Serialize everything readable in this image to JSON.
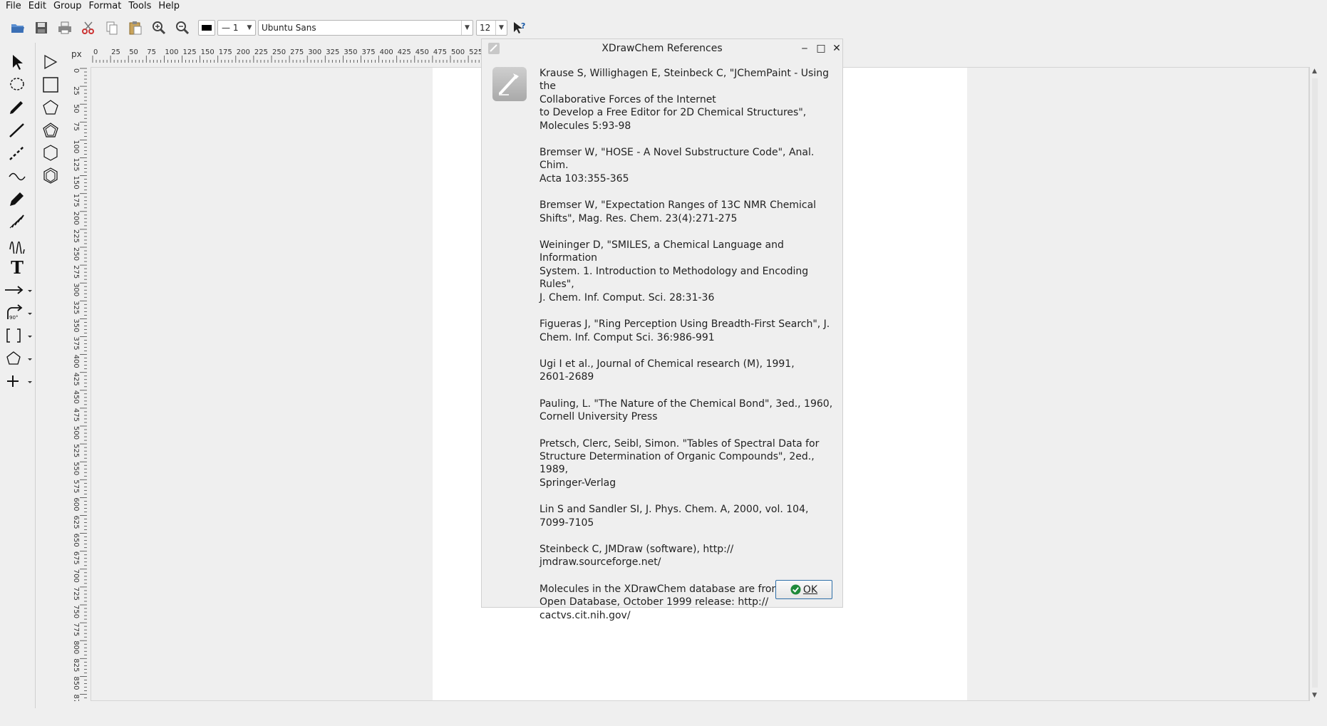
{
  "menubar": {
    "items": [
      "File",
      "Edit",
      "Group",
      "Format",
      "Tools",
      "Help"
    ]
  },
  "toolbar": {
    "icons": [
      "open-folder-icon",
      "save-icon",
      "print-icon",
      "cut-icon",
      "copy-icon",
      "paste-icon",
      "zoom-in-icon",
      "zoom-out-icon"
    ],
    "line_width": "— 1",
    "font_family": "Ubuntu Sans",
    "font_size": "12",
    "help_icon": "whats-this-icon"
  },
  "palette": {
    "tools": [
      "select-arrow-icon",
      "lasso-icon",
      "pencil-icon",
      "line-icon",
      "dashed-line-icon",
      "wavy-line-icon",
      "pen-icon",
      "hatch-icon",
      "squiggle-icon",
      "text-tool-icon",
      "arrow-tool-icon",
      "curved-arrow-icon",
      "bracket-icon",
      "ring-icon",
      "plus-icon"
    ],
    "tools_right": [
      "rotate-select-icon",
      "rectangle-icon",
      "pentagon-icon",
      "pentagon-filled-icon",
      "hexagon-icon",
      "hexagon-3d-icon"
    ],
    "text_tool_label": "T",
    "curved_arrow_label": "90°"
  },
  "ruler": {
    "unit": "px",
    "h_ticks": [
      "0",
      "25",
      "50",
      "75",
      "100",
      "125",
      "150",
      "175",
      "200",
      "225",
      "250",
      "275",
      "300",
      "325",
      "350",
      "375",
      "400",
      "425",
      "450",
      "475",
      "500",
      "525",
      "55"
    ],
    "v_ticks": [
      "0",
      "25",
      "50",
      "75",
      "100",
      "125",
      "150",
      "175",
      "200",
      "225",
      "250",
      "275",
      "300",
      "325",
      "350",
      "375",
      "400",
      "425",
      "450",
      "475",
      "500",
      "525",
      "550",
      "575",
      "600",
      "625",
      "650",
      "675",
      "700",
      "725",
      "750",
      "775",
      "800",
      "825",
      "850",
      "875"
    ]
  },
  "dialog": {
    "title": "XDrawChem References",
    "references": [
      "Krause S, Willighagen E, Steinbeck C, \"JChemPaint - Using the\nCollaborative Forces of the Internet\nto Develop a Free Editor for 2D Chemical Structures\",\nMolecules 5:93-98",
      "Bremser W, \"HOSE - A Novel Substructure Code\", Anal. Chim.\nActa 103:355-365",
      "Bremser W, \"Expectation Ranges of 13C NMR Chemical\nShifts\", Mag. Res. Chem. 23(4):271-275",
      "Weininger D, \"SMILES, a Chemical Language and Information\nSystem.  1. Introduction to Methodology and Encoding\nRules\",\nJ. Chem. Inf. Comput. Sci. 28:31-36",
      "Figueras J, \"Ring Perception Using Breadth-First Search\", J.\nChem. Inf. Comput Sci. 36:986-991",
      "Ugi I et al., Journal of Chemical research (M), 1991,\n2601-2689",
      "Pauling, L. \"The Nature of the Chemical Bond\", 3ed., 1960,\nCornell University Press",
      "Pretsch, Clerc, Seibl, Simon. \"Tables of Spectral Data for\nStructure Determination of Organic Compounds\", 2ed., 1989,\nSpringer-Verlag",
      "Lin S and Sandler SI, J. Phys. Chem. A, 2000, vol. 104,\n7099-7105",
      "Steinbeck C, JMDraw (software), http://\njmdraw.sourceforge.net/",
      "Molecules in the XDrawChem database are from the NCI\nOpen Database, October 1999 release:  http://\ncactvs.cit.nih.gov/"
    ],
    "ok_label": "OK",
    "minimize": "‒",
    "maximize": "□",
    "close": "✕"
  }
}
